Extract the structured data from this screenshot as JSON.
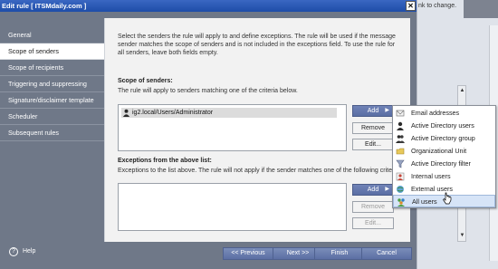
{
  "window": {
    "title": "Edit rule [ ITSMdaily.com ]",
    "close_glyph": "✕"
  },
  "background": {
    "text": "nk to change."
  },
  "sidebar": {
    "items": [
      {
        "label": "General"
      },
      {
        "label": "Scope of senders"
      },
      {
        "label": "Scope of recipients"
      },
      {
        "label": "Triggering and suppressing"
      },
      {
        "label": "Signature/disclaimer template"
      },
      {
        "label": "Scheduler"
      },
      {
        "label": "Subsequent rules"
      }
    ]
  },
  "main": {
    "description": "Select the senders the rule will apply to and define exceptions. The rule will be used if the message sender matches the scope of senders and is not included in the exceptions field. To use the rule for all senders, leave both fields empty.",
    "scope": {
      "title": "Scope of senders:",
      "subtitle": "The rule will apply to senders matching one of the criteria below.",
      "items": [
        "ig2.local/Users/Administrator"
      ]
    },
    "exceptions": {
      "title": "Exceptions from the above list:",
      "subtitle": "Exceptions to the list above. The rule will not apply if the sender matches one of the following criteria."
    }
  },
  "buttons": {
    "add": "Add",
    "remove": "Remove",
    "edit": "Edit...",
    "add2": "Add",
    "remove2": "Remove",
    "edit2": "Edit..."
  },
  "menu": {
    "items": [
      {
        "label": "Email addresses",
        "icon": "envelope-icon"
      },
      {
        "label": "Active Directory users",
        "icon": "ad-user-icon"
      },
      {
        "label": "Active Directory group",
        "icon": "ad-group-icon"
      },
      {
        "label": "Organizational Unit",
        "icon": "ou-icon"
      },
      {
        "label": "Active Directory filter",
        "icon": "filter-icon"
      },
      {
        "label": "Internal users",
        "icon": "internal-users-icon"
      },
      {
        "label": "External users",
        "icon": "external-users-icon"
      },
      {
        "label": "All users",
        "icon": "all-users-icon"
      }
    ],
    "highlighted_index": 7
  },
  "footer": {
    "help": "Help",
    "previous": "<< Previous",
    "next": "Next >>",
    "finish": "Finish",
    "cancel": "Cancel"
  }
}
